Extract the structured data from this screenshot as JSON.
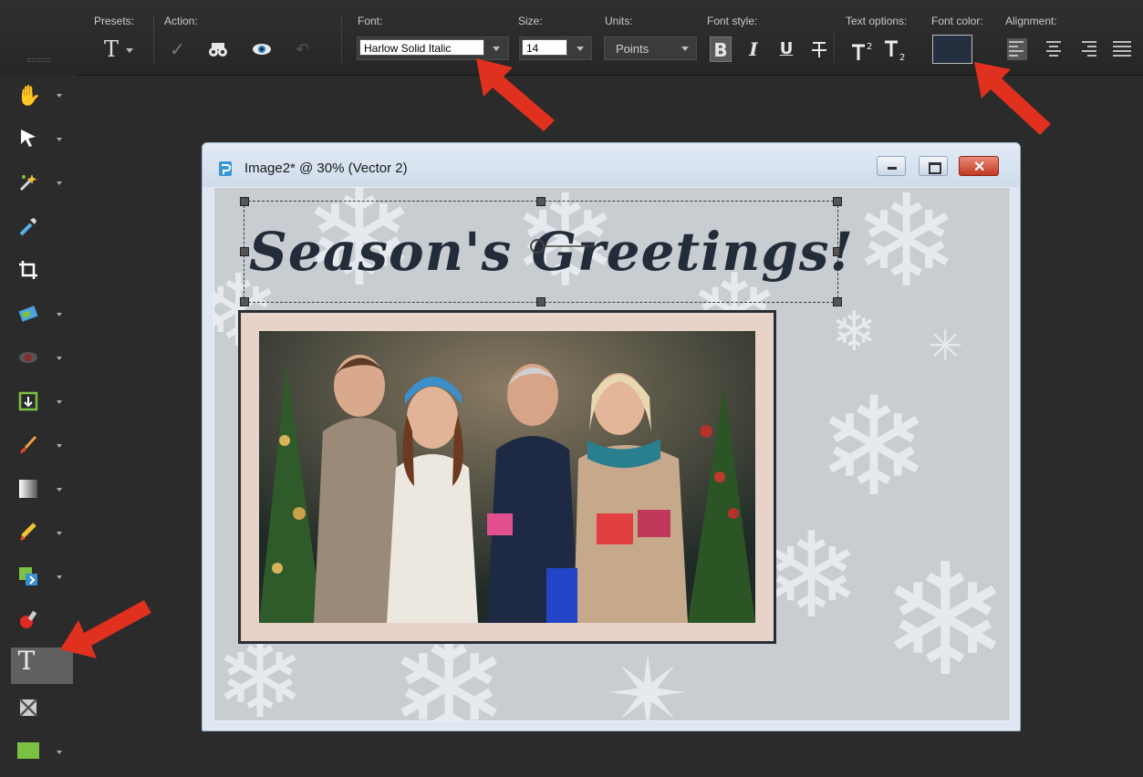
{
  "toolbar": {
    "presets_label": "Presets:",
    "action_label": "Action:",
    "font_label": "Font:",
    "font_value": "Harlow Solid Italic",
    "size_label": "Size:",
    "size_value": "14",
    "units_label": "Units:",
    "units_value": "Points",
    "font_style_label": "Font style:",
    "text_options_label": "Text options:",
    "font_color_label": "Font color:",
    "alignment_label": "Alignment:",
    "font_color": "#243040",
    "preset_glyph": "T",
    "style_buttons": [
      "B",
      "I",
      "U"
    ]
  },
  "tools": [
    {
      "name": "pan-tool",
      "icon": "hand-icon"
    },
    {
      "name": "pick-tool",
      "icon": "arrow-icon"
    },
    {
      "name": "magic-wand-tool",
      "icon": "wand-icon"
    },
    {
      "name": "dropper-tool",
      "icon": "dropper-icon"
    },
    {
      "name": "crop-tool",
      "icon": "crop-icon"
    },
    {
      "name": "straighten-tool",
      "icon": "photo-icon"
    },
    {
      "name": "red-eye-tool",
      "icon": "eye-icon"
    },
    {
      "name": "clone-tool",
      "icon": "clone-icon"
    },
    {
      "name": "paint-brush-tool",
      "icon": "brush-icon"
    },
    {
      "name": "gradient-tool",
      "icon": "gradient-icon"
    },
    {
      "name": "pencil-tool",
      "icon": "pencil-icon"
    },
    {
      "name": "fill-tool",
      "icon": "fill-icon"
    },
    {
      "name": "pin-tool",
      "icon": "pin-icon"
    },
    {
      "name": "text-tool",
      "icon": "text-icon",
      "glyph": "T",
      "active": true
    },
    {
      "name": "warp-tool",
      "icon": "warp-icon"
    },
    {
      "name": "shape-tool",
      "icon": "rectangle-icon"
    }
  ],
  "document": {
    "title": "Image2* @  30% (Vector 2)",
    "greeting_text": "Season's Greetings!",
    "greeting_color": "#232d3a"
  },
  "colors": {
    "callout": "#e0301e",
    "canvas": "#c8cdd2",
    "frame_mat": "#e8d3c8"
  }
}
